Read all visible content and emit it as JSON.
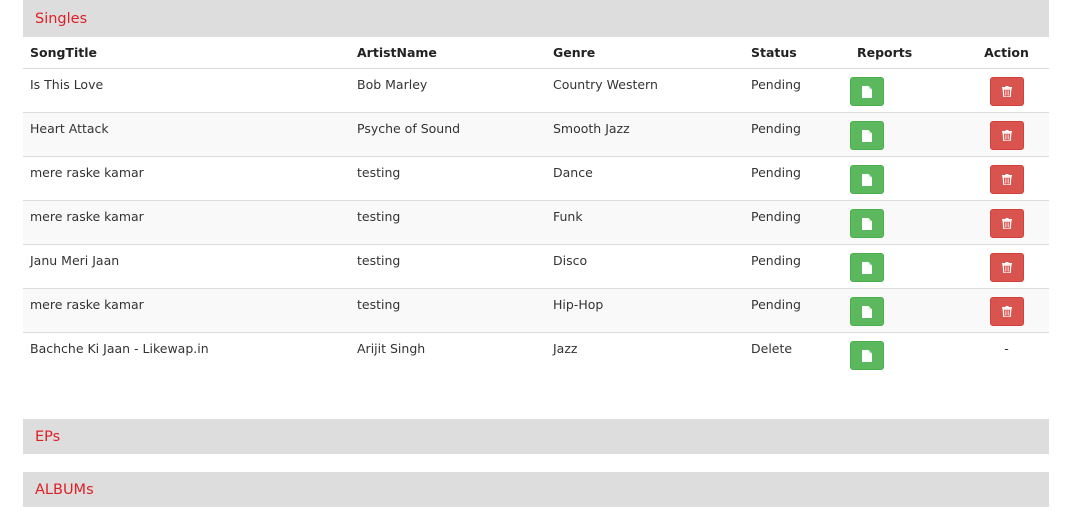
{
  "sections": {
    "singles": "Singles",
    "eps": "EPs",
    "albums": "ALBUMs"
  },
  "columns": {
    "song_title": "SongTitle",
    "artist_name": "ArtistName",
    "genre": "Genre",
    "status": "Status",
    "reports": "Reports",
    "action": "Action"
  },
  "rows": [
    {
      "title": "Is This Love",
      "artist": "Bob Marley",
      "genre": "Country Western",
      "status": "Pending",
      "action": "delete"
    },
    {
      "title": "Heart Attack",
      "artist": "Psyche of Sound",
      "genre": "Smooth Jazz",
      "status": "Pending",
      "action": "delete"
    },
    {
      "title": "mere raske kamar",
      "artist": "testing",
      "genre": "Dance",
      "status": "Pending",
      "action": "delete"
    },
    {
      "title": "mere raske kamar",
      "artist": "testing",
      "genre": "Funk",
      "status": "Pending",
      "action": "delete"
    },
    {
      "title": "Janu Meri Jaan",
      "artist": "testing",
      "genre": "Disco",
      "status": "Pending",
      "action": "delete"
    },
    {
      "title": "mere raske kamar",
      "artist": "testing",
      "genre": "Hip-Hop",
      "status": "Pending",
      "action": "delete"
    },
    {
      "title": "Bachche Ki Jaan - Likewap.in",
      "artist": "Arijit Singh",
      "genre": "Jazz",
      "status": "Delete",
      "action": "-"
    }
  ],
  "icons": {
    "report": "file-icon",
    "delete": "trash-icon"
  },
  "colors": {
    "section_title": "#dd1f26",
    "section_bg": "#dddddd",
    "report_button": "#5cb85c",
    "delete_button": "#d9534f"
  }
}
